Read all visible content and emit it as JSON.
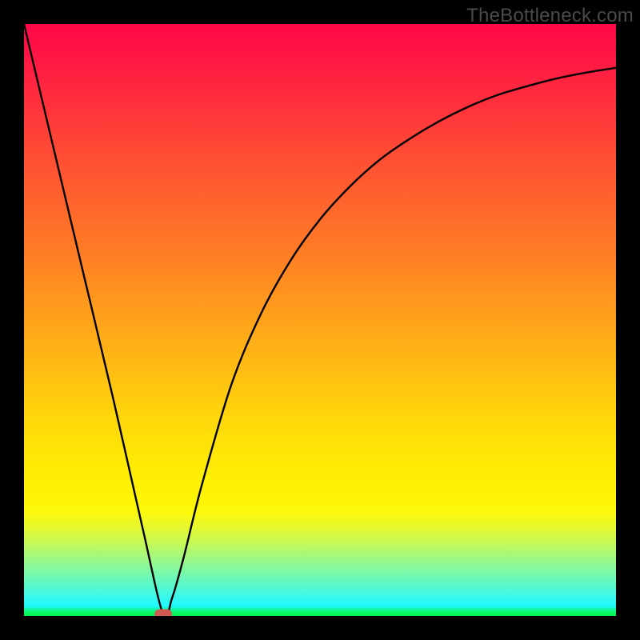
{
  "watermark": "TheBottleneck.com",
  "colors": {
    "frame": "#000000",
    "marker": "#d05a52",
    "curve": "#000000"
  },
  "chart_data": {
    "type": "line",
    "title": "",
    "xlabel": "",
    "ylabel": "",
    "xlim": [
      0,
      100
    ],
    "ylim": [
      0,
      100
    ],
    "grid": false,
    "series": [
      {
        "name": "curve",
        "x": [
          0,
          5,
          10,
          15,
          20,
          23.5,
          25,
          27,
          30,
          35,
          40,
          45,
          50,
          55,
          60,
          65,
          70,
          75,
          80,
          85,
          90,
          95,
          100
        ],
        "y": [
          100,
          79,
          58,
          37,
          15,
          0.3,
          3,
          10,
          22,
          39,
          51,
          60,
          67,
          72.5,
          77,
          80.5,
          83.5,
          86,
          88,
          89.5,
          90.8,
          91.8,
          92.6
        ]
      }
    ],
    "annotations": [
      {
        "name": "minimum-marker",
        "x": 23.5,
        "y": 0.3
      }
    ],
    "background_gradient": {
      "direction": "vertical",
      "stops": [
        {
          "pos": 0.0,
          "color": "#ff0746"
        },
        {
          "pos": 0.22,
          "color": "#ff4c34"
        },
        {
          "pos": 0.55,
          "color": "#ffb216"
        },
        {
          "pos": 0.8,
          "color": "#fff403"
        },
        {
          "pos": 0.94,
          "color": "#65f8bf"
        },
        {
          "pos": 1.0,
          "color": "#06f34b"
        }
      ]
    }
  }
}
